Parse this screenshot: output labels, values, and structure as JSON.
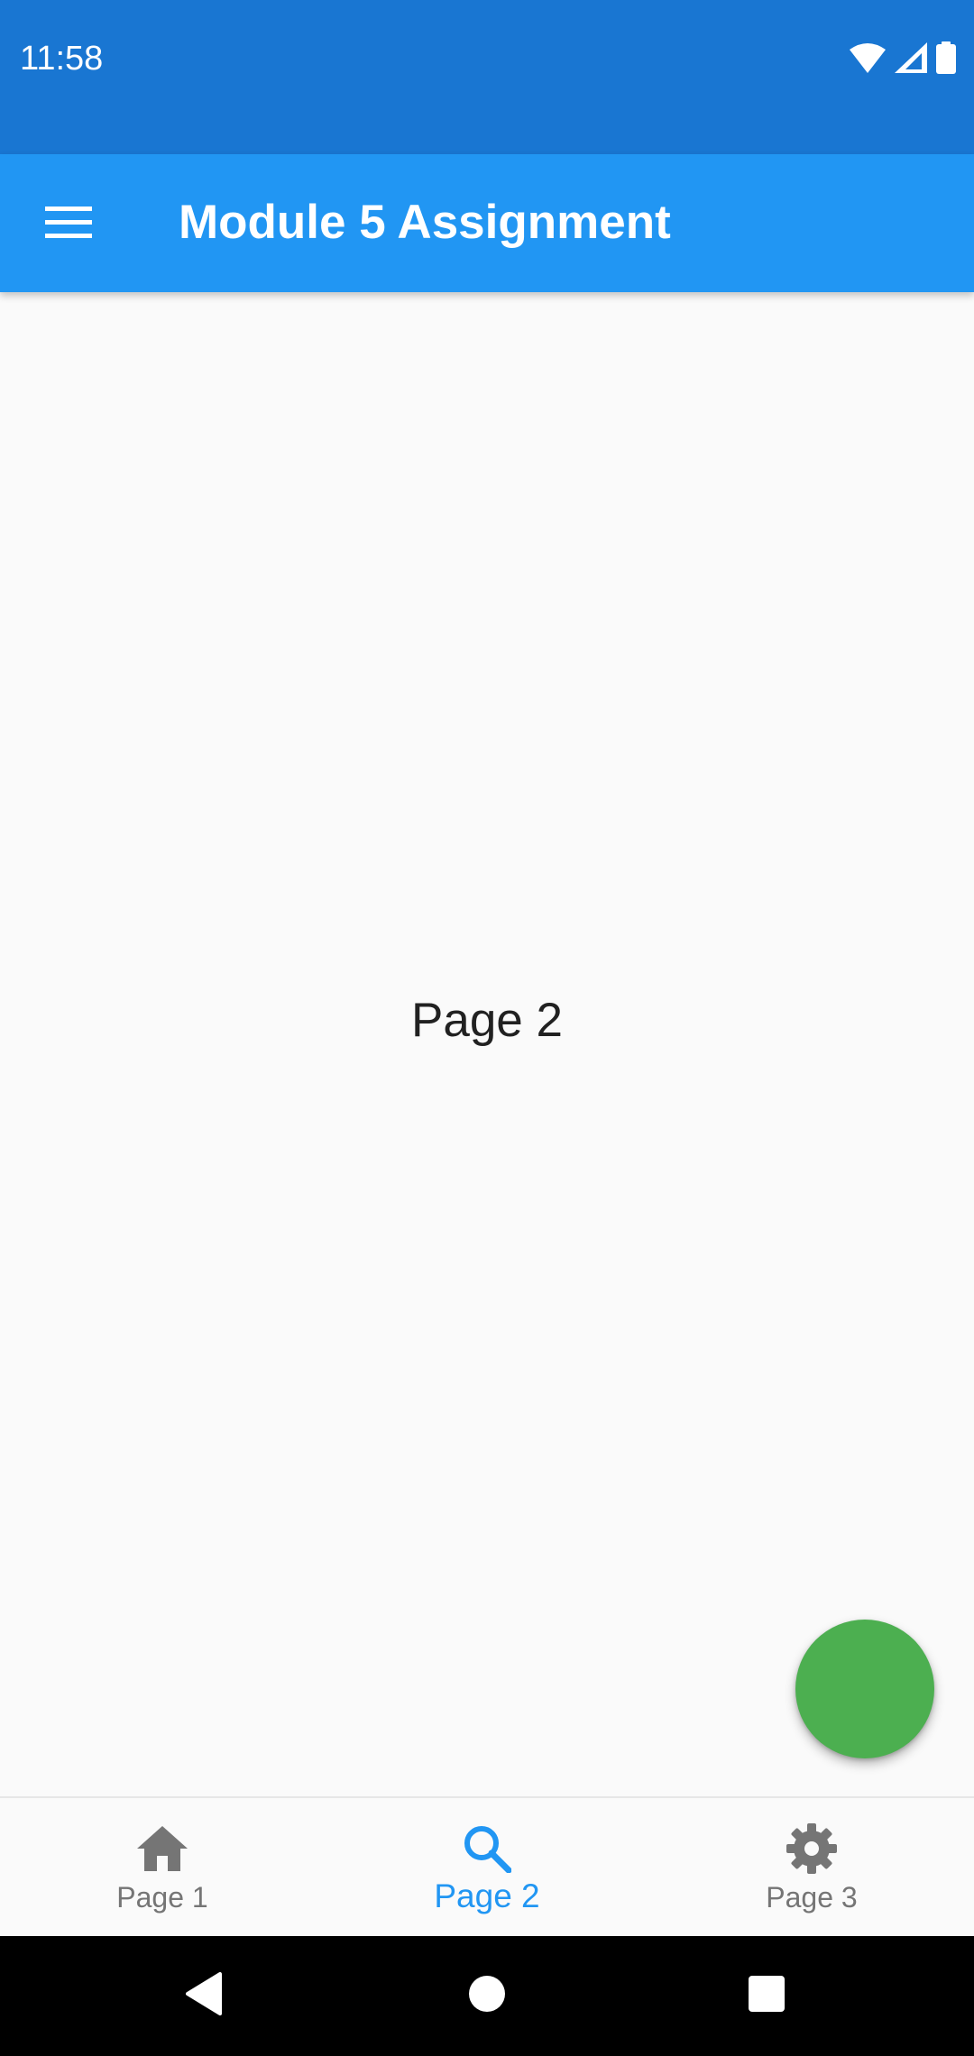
{
  "status_bar": {
    "time": "11:58",
    "background": "#1976d2",
    "icons": [
      "wifi-icon",
      "cell-signal-icon",
      "battery-icon"
    ]
  },
  "app_bar": {
    "title": "Module 5 Assignment",
    "background": "#2196f3",
    "menu_icon": "hamburger-menu-icon"
  },
  "content": {
    "page_label": "Page 2"
  },
  "fab": {
    "color": "#4caf50"
  },
  "bottom_nav": {
    "active_color": "#2196f3",
    "inactive_color": "#757575",
    "items": [
      {
        "label": "Page 1",
        "icon": "home-icon",
        "active": false
      },
      {
        "label": "Page 2",
        "icon": "search-icon",
        "active": true
      },
      {
        "label": "Page 3",
        "icon": "gear-icon",
        "active": false
      }
    ]
  },
  "system_nav": {
    "buttons": [
      "back-icon",
      "home-circle-icon",
      "recents-icon"
    ]
  }
}
